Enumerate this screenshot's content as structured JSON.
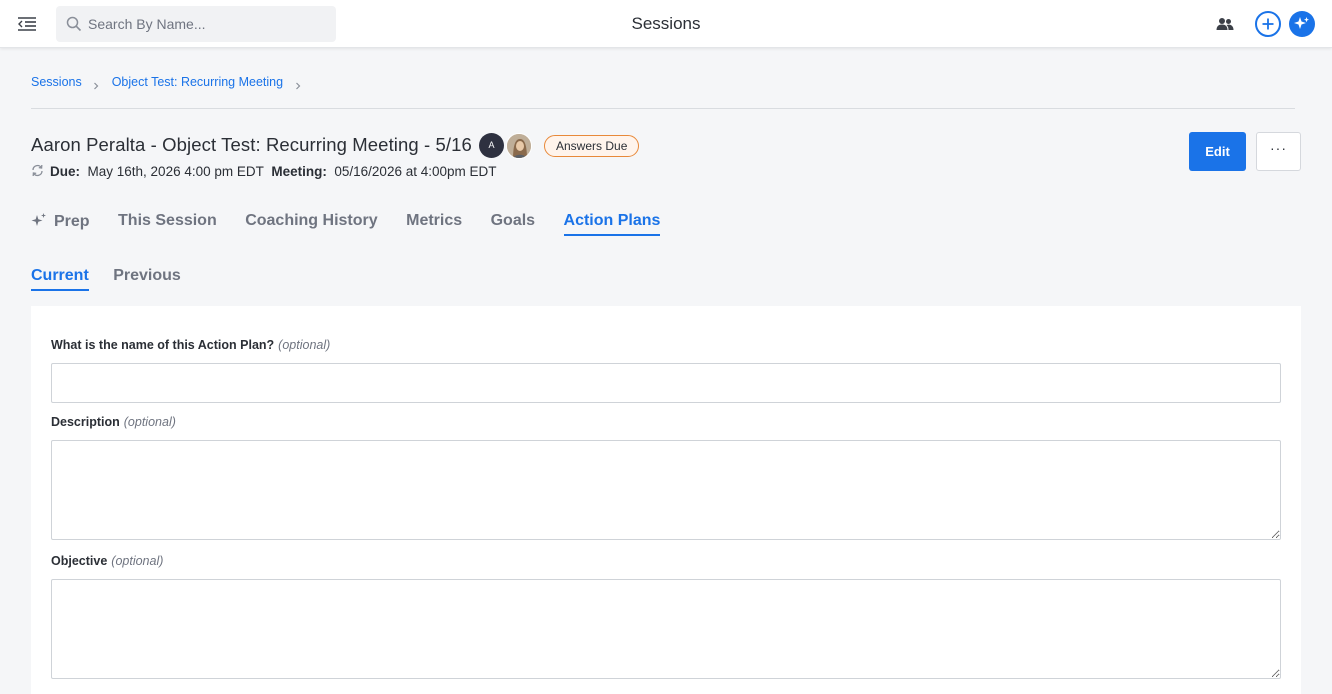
{
  "topbar": {
    "title": "Sessions",
    "search": {
      "placeholder": "Search By Name...",
      "value": ""
    },
    "icons": {
      "menu": "menu-collapse-icon",
      "search": "search-icon",
      "people": "people-icon",
      "plus": "plus-icon",
      "ai": "sparkle-icon"
    }
  },
  "breadcrumb": {
    "items": [
      "Sessions",
      "Object Test: Recurring Meeting"
    ]
  },
  "session": {
    "title": "Aaron Peralta - Object Test: Recurring Meeting - 5/16",
    "avatar_initial": "A",
    "status": "Answers Due",
    "due_label": "Due:",
    "due_value": "May 16th, 2026 4:00 pm EDT",
    "meeting_label": "Meeting:",
    "meeting_value": "05/16/2026 at 4:00pm EDT",
    "edit_label": "Edit",
    "more_label": "···"
  },
  "tabs": {
    "items": [
      "Prep",
      "This Session",
      "Coaching History",
      "Metrics",
      "Goals",
      "Action Plans"
    ],
    "active": "Action Plans"
  },
  "subtabs": {
    "items": [
      "Current",
      "Previous"
    ],
    "active": "Current"
  },
  "form": {
    "name_label": "What is the name of this Action Plan?",
    "name_value": "",
    "description_label": "Description",
    "description_value": "",
    "objective_label": "Objective",
    "objective_value": "",
    "optional_text": "(optional)"
  },
  "colors": {
    "accent": "#1a73e8",
    "status_border": "#e8893a",
    "page_bg": "#f5f6f8"
  }
}
